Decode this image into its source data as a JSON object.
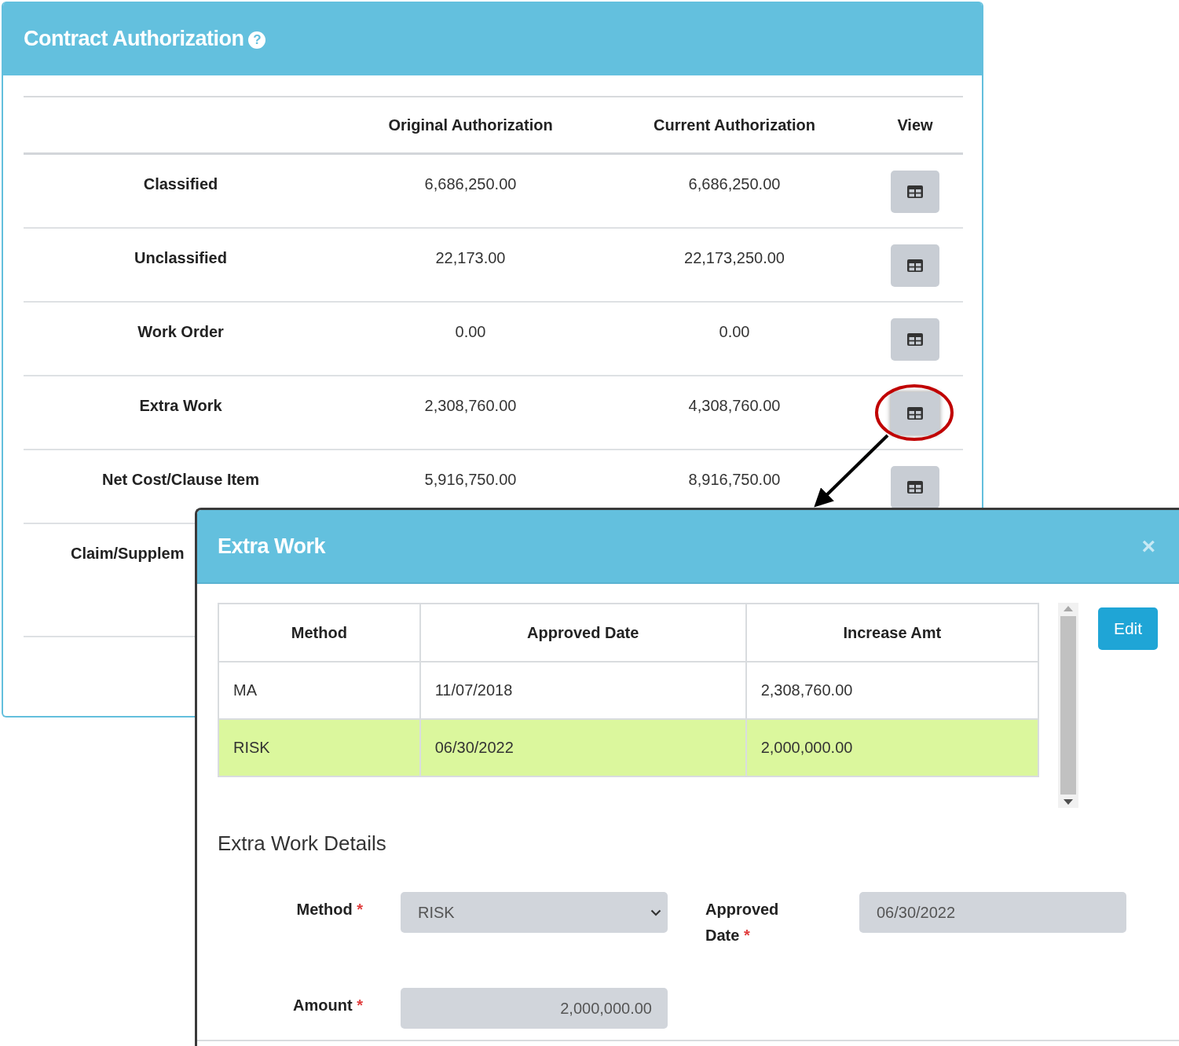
{
  "panel": {
    "title": "Contract Authorization",
    "help_icon": "?",
    "columns": [
      "Original Authorization",
      "Current Authorization",
      "View"
    ],
    "rows": [
      {
        "label": "Classified",
        "original": "6,686,250.00",
        "current": "6,686,250.00",
        "highlighted": false
      },
      {
        "label": "Unclassified",
        "original": "22,173.00",
        "current": "22,173,250.00",
        "highlighted": false
      },
      {
        "label": "Work Order",
        "original": "0.00",
        "current": "0.00",
        "highlighted": false
      },
      {
        "label": "Extra Work",
        "original": "2,308,760.00",
        "current": "4,308,760.00",
        "highlighted": true
      },
      {
        "label": "Net Cost/Clause Item",
        "original": "5,916,750.00",
        "current": "8,916,750.00",
        "highlighted": false
      },
      {
        "label": "Claim/Supplem"
      }
    ]
  },
  "modal": {
    "title": "Extra Work",
    "close": "×",
    "columns": [
      "Method",
      "Approved Date",
      "Increase Amt"
    ],
    "rows": [
      {
        "cells": [
          "MA",
          "11/07/2018",
          "2,308,760.00"
        ],
        "selected": false
      },
      {
        "cells": [
          "RISK",
          "06/30/2022",
          "2,000,000.00"
        ],
        "selected": true
      }
    ],
    "edit_button": "Edit",
    "details_title": "Extra Work Details",
    "required_mark": "*",
    "fields": [
      {
        "label": "Method",
        "kind": "select",
        "value": "RISK",
        "required": true
      },
      {
        "label": "Approved Date",
        "kind": "date",
        "value": "06/30/2022",
        "required": true
      },
      {
        "label": "Amount",
        "kind": "amount",
        "value": "2,000,000.00",
        "required": true
      }
    ]
  }
}
